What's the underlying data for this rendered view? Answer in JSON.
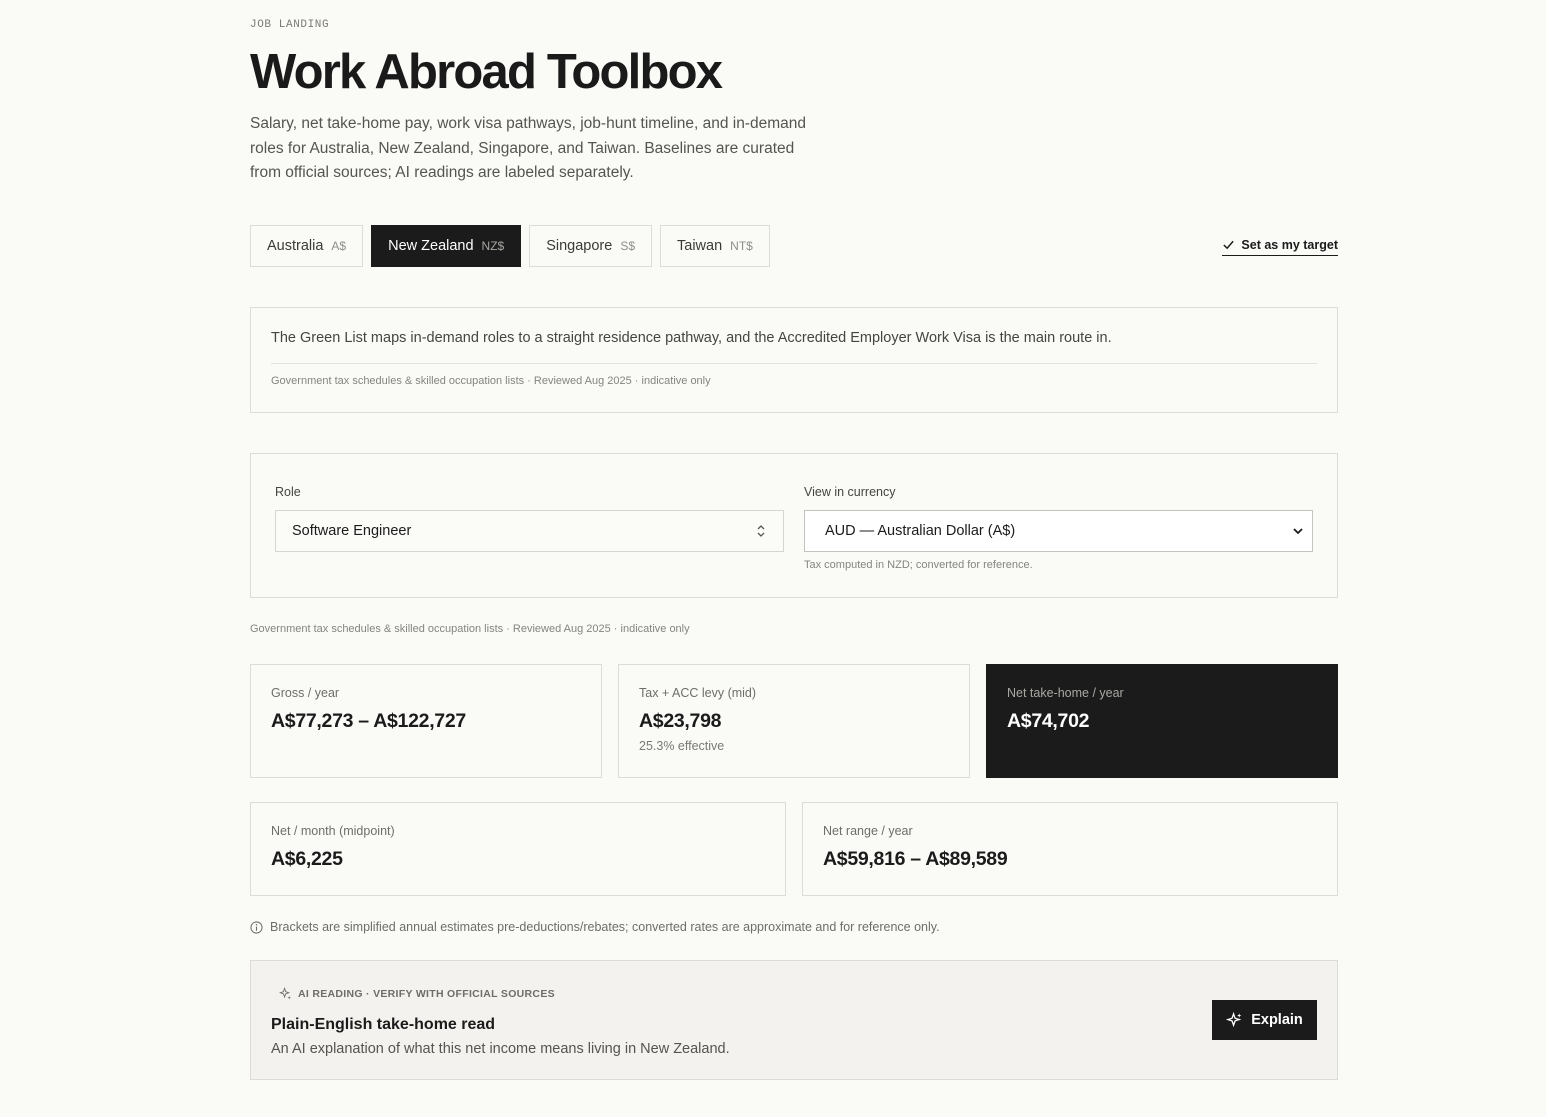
{
  "header": {
    "eyebrow": "JOB LANDING",
    "title": "Work Abroad Toolbox",
    "intro": "Salary, net take-home pay, work visa pathways, job-hunt timeline, and in-demand roles for Australia, New Zealand, Singapore, and Taiwan. Baselines are curated from official sources; AI readings are labeled separately."
  },
  "tabs": [
    {
      "name": "Australia",
      "currency": "A$",
      "active": false
    },
    {
      "name": "New Zealand",
      "currency": "NZ$",
      "active": true
    },
    {
      "name": "Singapore",
      "currency": "S$",
      "active": false
    },
    {
      "name": "Taiwan",
      "currency": "NT$",
      "active": false
    }
  ],
  "target_link": {
    "label": "Set as my target",
    "icon": "check-icon"
  },
  "info": {
    "text": "The Green List maps in-demand roles to a straight residence pathway, and the Accredited Employer Work Visa is the main route in.",
    "source": "Government tax schedules & skilled occupation lists · Reviewed Aug 2025 · indicative only"
  },
  "selectors": {
    "role_label": "Role",
    "role_value": "Software Engineer",
    "currency_label": "View in currency",
    "currency_value": "AUD — Australian Dollar (A$)",
    "currency_note": "Tax computed in NZD; converted for reference."
  },
  "source_line": "Government tax schedules & skilled occupation lists · Reviewed Aug 2025 · indicative only",
  "stats": {
    "gross": {
      "label": "Gross / year",
      "value": "A$77,273 – A$122,727"
    },
    "tax": {
      "label": "Tax + ACC levy (mid)",
      "value": "A$23,798",
      "sub": "25.3% effective"
    },
    "net": {
      "label": "Net take-home / year",
      "value": "A$74,702"
    },
    "net_month": {
      "label": "Net / month (midpoint)",
      "value": "A$6,225"
    },
    "net_range": {
      "label": "Net range / year",
      "value": "A$59,816 – A$89,589"
    }
  },
  "note": "Brackets are simplified annual estimates pre-deductions/rebates; converted rates are approximate and for reference only.",
  "ai": {
    "eyebrow": "AI READING · VERIFY WITH OFFICIAL SOURCES",
    "title": "Plain-English take-home read",
    "description": "An AI explanation of what this net income means living in New Zealand.",
    "button": "Explain",
    "icon": "sparkle-icon"
  }
}
